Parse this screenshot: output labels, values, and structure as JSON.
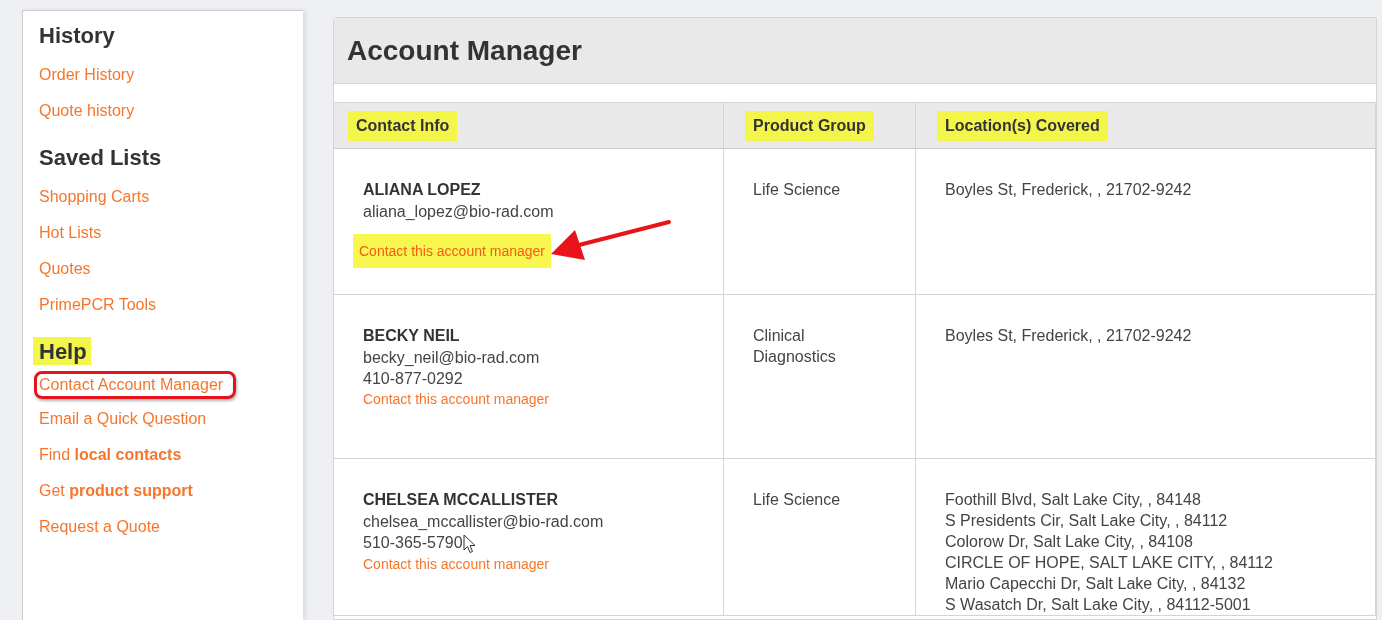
{
  "sidebar": [
    {
      "heading": "History",
      "highlighted": false,
      "links": [
        {
          "text": "Order History",
          "outlined": false
        },
        {
          "text": "Quote history",
          "outlined": false
        }
      ]
    },
    {
      "heading": "Saved Lists",
      "highlighted": false,
      "links": [
        {
          "text": "Shopping Carts",
          "outlined": false
        },
        {
          "text": "Hot Lists",
          "outlined": false
        },
        {
          "text": "Quotes",
          "outlined": false
        },
        {
          "text": "PrimePCR Tools",
          "outlined": false
        }
      ]
    },
    {
      "heading": "Help",
      "highlighted": true,
      "links": [
        {
          "text": "Contact Account Manager",
          "outlined": true
        },
        {
          "text": "Email a Quick Question",
          "outlined": false
        },
        {
          "text": "Find **local contacts**",
          "outlined": false
        },
        {
          "text": "Get **product support**",
          "outlined": false
        },
        {
          "text": "Request a Quote",
          "outlined": false
        }
      ]
    }
  ],
  "panel": {
    "title": "Account Manager",
    "table": {
      "columns": [
        {
          "label": "Contact Info",
          "highlighted": true
        },
        {
          "label": "Product Group",
          "highlighted": true
        },
        {
          "label": "Location(s) Covered",
          "highlighted": true
        }
      ],
      "rows": [
        {
          "name": "ALIANA LOPEZ",
          "email": "aliana_lopez@bio-rad.com",
          "contact_link": {
            "text": "Contact this account manager",
            "highlighted": true
          },
          "arrow": true,
          "cursor": false,
          "product_group": "Life Science",
          "locations": [
            "Boyles St, Frederick, , 21702-9242"
          ]
        },
        {
          "name": "BECKY NEIL",
          "email": "becky_neil@bio-rad.com",
          "phone": "410-877-0292",
          "contact_link": {
            "text": "Contact this account manager",
            "highlighted": false
          },
          "arrow": false,
          "cursor": false,
          "product_group": "Clinical Diagnostics",
          "locations": [
            "Boyles St, Frederick, , 21702-9242"
          ]
        },
        {
          "name": "CHELSEA MCCALLISTER",
          "email": "chelsea_mccallister@bio-rad.com",
          "phone": "510-365-5790",
          "contact_link": {
            "text": "Contact this account manager",
            "highlighted": false
          },
          "arrow": false,
          "cursor": true,
          "product_group": "Life Science",
          "locations": [
            "Foothill Blvd, Salt Lake City, , 84148",
            "S Presidents Cir, Salt Lake City, , 84112",
            "Colorow Dr, Salt Lake City, , 84108",
            "CIRCLE OF HOPE, SALT LAKE CITY, , 84112",
            "Mario Capecchi Dr, Salt Lake City, , 84132",
            "S Wasatch Dr, Salt Lake City, , 84112-5001"
          ]
        }
      ]
    }
  }
}
